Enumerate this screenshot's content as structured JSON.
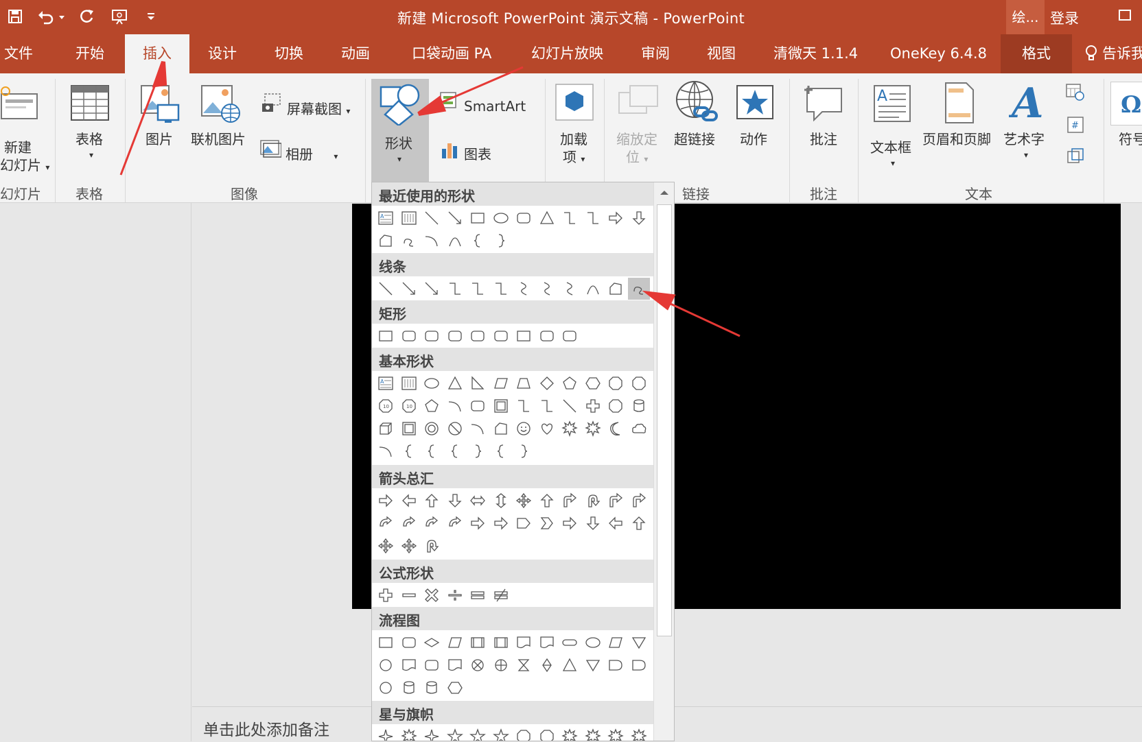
{
  "window": {
    "title": "新建 Microsoft PowerPoint 演示文稿  -  PowerPoint",
    "tell_me_short": "绘...",
    "login": "登录",
    "tell_me": "告诉我"
  },
  "tabs": [
    "文件",
    "开始",
    "插入",
    "设计",
    "切换",
    "动画",
    "口袋动画 PA",
    "幻灯片放映",
    "审阅",
    "视图",
    "清微天 1.1.4",
    "OneKey 6.4.8",
    "格式"
  ],
  "active_tab": "插入",
  "ribbon": {
    "new_slide_line1": "新建",
    "new_slide_line2": "幻灯片",
    "table": "表格",
    "picture": "图片",
    "online_picture": "联机图片",
    "screenshot": "屏幕截图",
    "album": "相册",
    "shapes": "形状",
    "smartart": "SmartArt",
    "chart": "图表",
    "addins_line1": "加载",
    "addins_line2": "项",
    "zoom_line1": "缩放定",
    "zoom_line2": "位",
    "hyperlink": "超链接",
    "action": "动作",
    "comment": "批注",
    "textbox": "文本框",
    "header_footer": "页眉和页脚",
    "wordart": "艺术字",
    "symbol": "符号",
    "groups": {
      "slides": "幻灯片",
      "tables": "表格",
      "images": "图像",
      "links": "链接",
      "comments": "批注",
      "text": "文本"
    }
  },
  "shapes_menu": {
    "sections": [
      "最近使用的形状",
      "线条",
      "矩形",
      "基本形状",
      "箭头总汇",
      "公式形状",
      "流程图",
      "星与旗帜"
    ],
    "highlighted_shape": "freeform-scribble"
  },
  "notes_placeholder": "单击此处添加备注",
  "colors": {
    "accent": "#b7472a",
    "annotation_arrow": "#e53935"
  }
}
